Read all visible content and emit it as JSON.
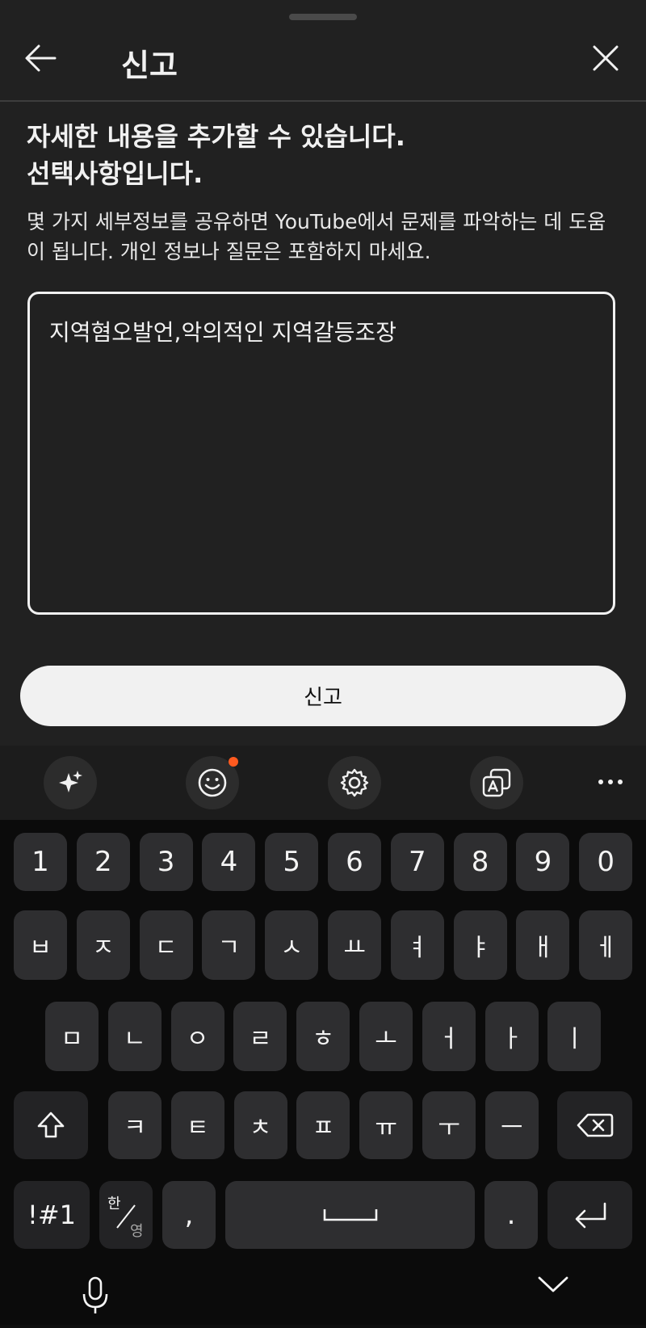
{
  "header": {
    "title": "신고"
  },
  "content": {
    "heading_line1": "자세한 내용을 추가할 수 있습니다.",
    "heading_line2": "선택사항입니다.",
    "description": "몇 가지 세부정보를 공유하면 YouTube에서 문제를 파악하는 데 도움이 됩니다. 개인 정보나 질문은 포함하지 마세요.",
    "textbox_value": "지역혐오발언,악의적인 지역갈등조장"
  },
  "submit_label": "신고",
  "keyboard": {
    "toolbar_icons": [
      "sparkle-icon",
      "emoji-icon",
      "settings-icon",
      "translate-icon",
      "more-icon"
    ],
    "row_numbers": [
      "1",
      "2",
      "3",
      "4",
      "5",
      "6",
      "7",
      "8",
      "9",
      "0"
    ],
    "row1": [
      "ㅂ",
      "ㅈ",
      "ㄷ",
      "ㄱ",
      "ㅅ",
      "ㅛ",
      "ㅕ",
      "ㅑ",
      "ㅐ",
      "ㅔ"
    ],
    "row2": [
      "ㅁ",
      "ㄴ",
      "ㅇ",
      "ㄹ",
      "ㅎ",
      "ㅗ",
      "ㅓ",
      "ㅏ",
      "ㅣ"
    ],
    "row3": [
      "ㅋ",
      "ㅌ",
      "ㅊ",
      "ㅍ",
      "ㅠ",
      "ㅜ",
      "ㅡ"
    ],
    "symbols_label": "!#1",
    "lang_top": "한",
    "lang_bottom": "영",
    "comma": ",",
    "period": "."
  },
  "colors": {
    "sheet_bg": "#212121",
    "keyboard_bg": "#0b0b0b",
    "key_bg": "#2e2e30",
    "accent_dot": "#ff5a1f"
  }
}
